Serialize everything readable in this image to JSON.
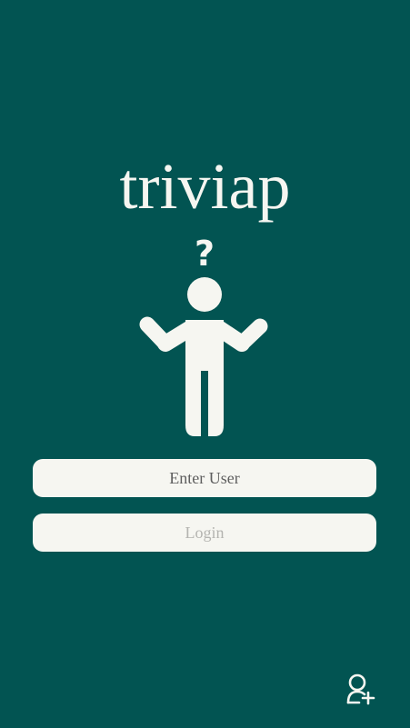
{
  "app": {
    "title": "triviap"
  },
  "mascot": {
    "icon": "confused-person-icon",
    "question_mark": "?"
  },
  "login_form": {
    "user_placeholder": "Enter User",
    "user_value": "",
    "login_label": "Login"
  },
  "footer": {
    "add_user_icon": "add-user-icon"
  },
  "colors": {
    "background": "#025452",
    "foreground": "#f6f6f1",
    "placeholder_text": "#5e5e5e",
    "disabled_text": "#b4b4b0"
  }
}
